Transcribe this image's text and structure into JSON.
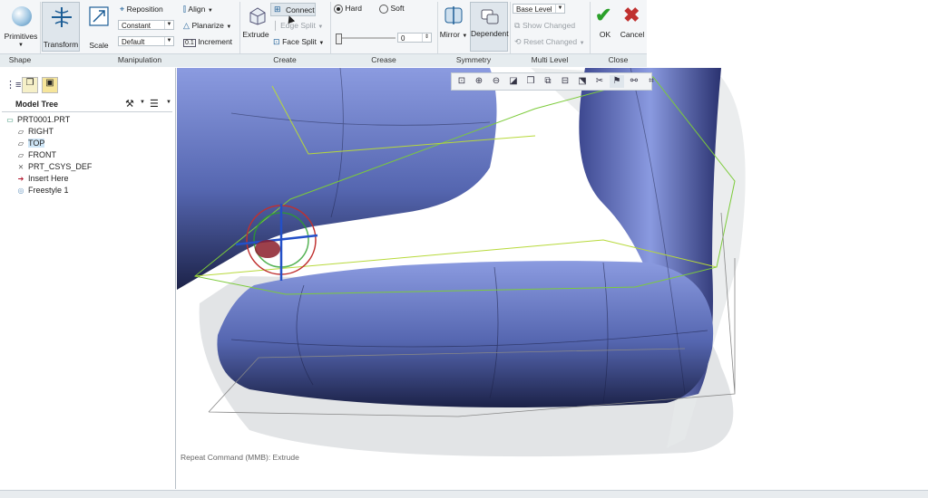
{
  "ribbon": {
    "shape": {
      "primitives": "Primitives",
      "group": "Shape"
    },
    "manipulation": {
      "transform": "Transform",
      "scale": "Scale",
      "reposition": "Reposition",
      "align": "Align",
      "planarize": "Planarize",
      "increment": "Increment",
      "combo1": "Constant",
      "combo2": "Default",
      "group": "Manipulation"
    },
    "create": {
      "extrude": "Extrude",
      "connect": "Connect",
      "edge_split": "Edge Split",
      "face_split": "Face Split",
      "group": "Create"
    },
    "crease": {
      "hard": "Hard",
      "soft": "Soft",
      "value": "0",
      "group": "Crease"
    },
    "symmetry": {
      "mirror": "Mirror",
      "dependent": "Dependent",
      "group": "Symmetry"
    },
    "multilevel": {
      "base_level": "Base Level",
      "show_changed": "Show Changed",
      "reset_changed": "Reset Changed",
      "group": "Multi Level"
    },
    "close": {
      "ok": "OK",
      "cancel": "Cancel",
      "group": "Close"
    }
  },
  "tree": {
    "title": "Model Tree",
    "items": [
      {
        "label": "PRT0001.PRT",
        "icon": "part-icon"
      },
      {
        "label": "RIGHT",
        "icon": "datum-plane-icon"
      },
      {
        "label": "TOP",
        "icon": "datum-plane-icon",
        "selected": true
      },
      {
        "label": "FRONT",
        "icon": "datum-plane-icon"
      },
      {
        "label": "PRT_CSYS_DEF",
        "icon": "csys-icon"
      },
      {
        "label": "Insert Here",
        "icon": "insert-arrow-icon"
      },
      {
        "label": "Freestyle 1",
        "icon": "freestyle-icon"
      }
    ]
  },
  "status": "Repeat Command (MMB): Extrude",
  "colors": {
    "accent": "#5a6fb5",
    "ok": "#2aa02a",
    "cancel": "#c0302f"
  }
}
